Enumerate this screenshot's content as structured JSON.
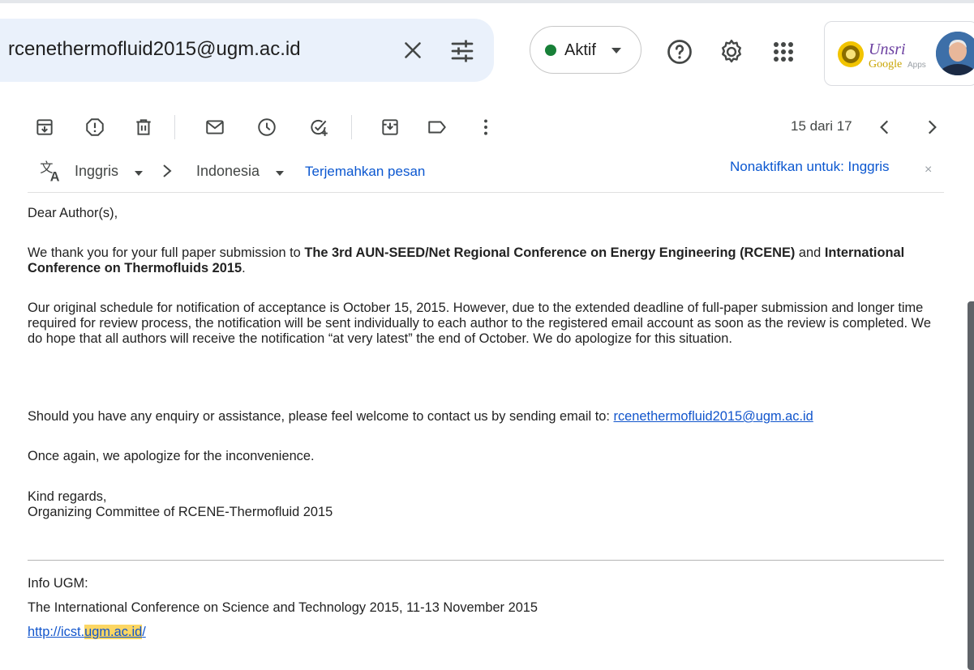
{
  "search": {
    "query": "rcenethermofluid2015@ugm.ac.id"
  },
  "header": {
    "status_label": "Aktif",
    "apps_logo_text": "Google Apps",
    "apps_logo_brand": "Unsri"
  },
  "toolbar": {
    "pager": "15 dari 17"
  },
  "translate": {
    "from_language": "Inggris",
    "to_language": "Indonesia",
    "translate_link": "Terjemahkan pesan",
    "disable_link": "Nonaktifkan untuk: Inggris",
    "close_glyph": "×"
  },
  "email": {
    "greeting": "Dear Author(s),",
    "p1_before": "We thank you for your full paper submission to ",
    "p1_bold1": "The 3rd AUN-SEED/Net Regional Conference on Energy Engineering (RCENE)",
    "p1_mid": " and ",
    "p1_bold2": "International Conference on Thermofluids 2015",
    "p1_end": ".",
    "p2": "Our original schedule for notification of acceptance is October 15, 2015. However, due to the extended deadline of full-paper submission and longer time required for review process, the notification will be sent individually to each author to the registered email account as soon as the review is completed. We do hope that all authors will receive the notification “at very latest” the end of October. We do apologize for this situation.",
    "p3_text": "Should you have any enquiry or assistance, please feel welcome to contact us by sending email to: ",
    "p3_link": "rcenethermofluid2015@ugm.ac.id",
    "p4": "Once again, we apologize for the inconvenience.",
    "sign_line1": "Kind regards,",
    "sign_line2": "Organizing Committee of RCENE-Thermofluid 2015",
    "info_title": "Info UGM:",
    "info_event": "The International Conference on Science and Technology 2015, 11-13 November 2015",
    "info_link_prefix": "http://icst.",
    "info_link_highlight": "ugm.ac.id",
    "info_link_suffix": "/"
  },
  "colors": {
    "search_bg": "#eaf1fb",
    "status_dot": "#188038",
    "link": "#1155cc",
    "translate_link": "#0b57d0",
    "highlight": "#fcd663"
  },
  "icons": {
    "search_clear": "close-icon",
    "search_filter": "tune-icon",
    "help": "help-icon",
    "settings": "gear-icon",
    "apps": "apps-grid-icon",
    "archive": "archive-icon",
    "spam": "report-spam-icon",
    "delete": "trash-icon",
    "unread": "mark-unread-icon",
    "snooze": "snooze-clock-icon",
    "add_task": "add-task-icon",
    "move": "move-to-icon",
    "label": "label-icon",
    "more": "more-vert-icon",
    "prev": "chevron-left-icon",
    "next": "chevron-right-icon",
    "translate": "translate-icon",
    "lang_arrow": "chevron-right-icon"
  }
}
